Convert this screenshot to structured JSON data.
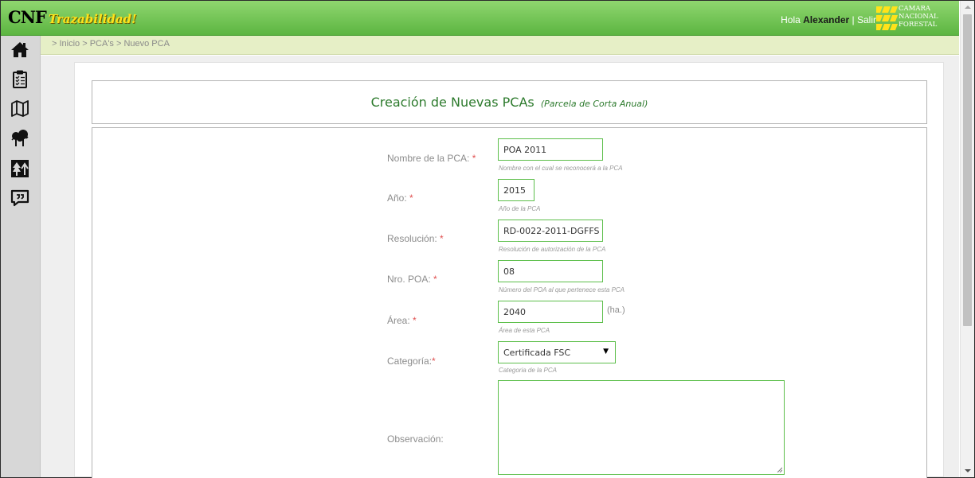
{
  "header": {
    "logo_main": "CNF",
    "logo_sub": "Trazabilidad!",
    "greeting": "Hola",
    "username": "Alexander",
    "separator": "|",
    "logout": "Salir",
    "org_logo_lines": [
      "CAMARA",
      "NACIONAL",
      "FORESTAL"
    ],
    "colors": {
      "header_green": "#6cc04f",
      "accent_yellow": "#ffe21a",
      "title_green": "#2c7a2c",
      "field_border": "#5dbf4b",
      "required_red": "#e05050"
    }
  },
  "breadcrumb": "> Inicio > PCA's > Nuevo PCA",
  "sidebar": {
    "items": [
      {
        "name": "home-icon"
      },
      {
        "name": "clipboard-icon"
      },
      {
        "name": "map-icon"
      },
      {
        "name": "trees-icon"
      },
      {
        "name": "forest-sign-icon"
      },
      {
        "name": "comment-icon"
      }
    ]
  },
  "form": {
    "title": "Creación de Nuevas PCAs",
    "subtitle": "(Parcela de Corta Anual)",
    "required_mark": "*",
    "fields": {
      "nombre": {
        "label": "Nombre de la PCA:",
        "value": "POA 2011",
        "help": "Nombre con el cual se reconocerá a la PCA"
      },
      "anio": {
        "label": "Año:",
        "value": "2015",
        "help": "Año de la PCA"
      },
      "resolucion": {
        "label": "Resolución:",
        "value": "RD-0022-2011-DGFFS",
        "help": "Resolución de autorización de la PCA"
      },
      "nro_poa": {
        "label": "Nro. POA:",
        "value": "08",
        "help": "Número del POA al que pertenece esta PCA"
      },
      "area": {
        "label": "Área:",
        "value": "2040",
        "unit": "(ha.)",
        "help": "Área de esta PCA"
      },
      "categoria": {
        "label": "Categoría:",
        "value": "Certificada FSC",
        "help": "Categoria de la PCA"
      },
      "observacion": {
        "label": "Observación:",
        "value": ""
      }
    }
  }
}
